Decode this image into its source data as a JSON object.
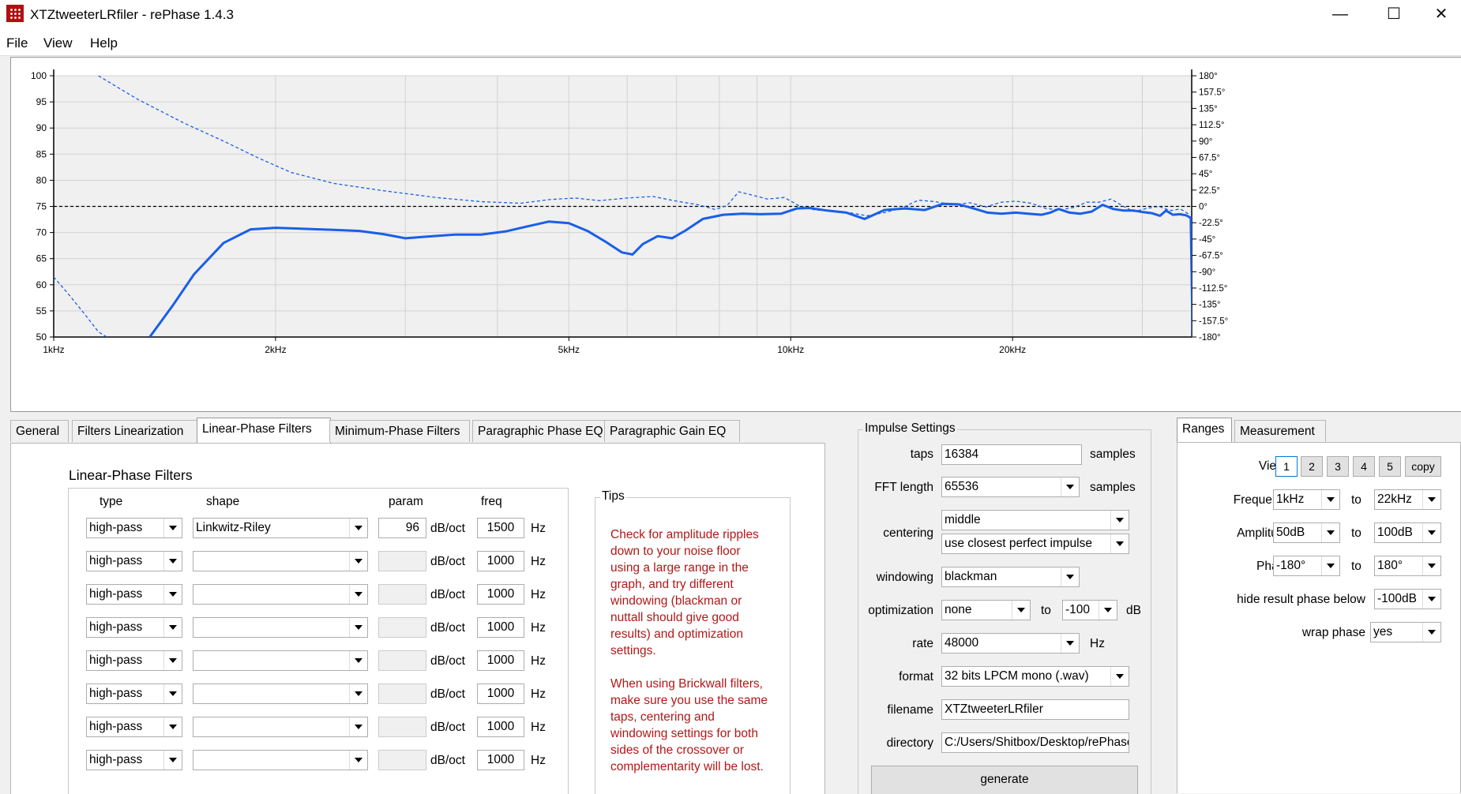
{
  "window": {
    "title": "XTZtweeterLRfiler  -  rePhase 1.4.3",
    "controls": {
      "minimize": "—",
      "maximize": "☐",
      "close": "✕"
    }
  },
  "menu": [
    "File",
    "View",
    "Help"
  ],
  "chart_data": {
    "type": "line",
    "x_scale": "log",
    "x_range_hz": [
      1000,
      22000
    ],
    "x_ticks": [
      {
        "hz": 1000,
        "label": "1kHz"
      },
      {
        "hz": 2000,
        "label": "2kHz"
      },
      {
        "hz": 5000,
        "label": "5kHz"
      },
      {
        "hz": 10000,
        "label": "10kHz"
      },
      {
        "hz": 20000,
        "label": "20kHz"
      }
    ],
    "y_left_range_db": [
      50,
      100
    ],
    "y_left_ticks": [
      "100",
      "95",
      "90",
      "85",
      "80",
      "75",
      "70",
      "65",
      "60",
      "55",
      "50"
    ],
    "y_right_ticks": [
      "180°",
      "157.5°",
      "135°",
      "112.5°",
      "90°",
      "67.5°",
      "45°",
      "22.5°",
      "0°",
      "-22.5°",
      "-45°",
      "-67.5°",
      "-90°",
      "-112.5°",
      "-135°",
      "-157.5°",
      "-180°"
    ],
    "reference_db": 75,
    "grid": true,
    "series": [
      {
        "style": "solid",
        "color": "#1a5fe6",
        "points": [
          [
            1350,
            50
          ],
          [
            1450,
            56
          ],
          [
            1550,
            62
          ],
          [
            1700,
            68
          ],
          [
            1850,
            70.6
          ],
          [
            2000,
            70.9
          ],
          [
            2200,
            70.7
          ],
          [
            2400,
            70.5
          ],
          [
            2600,
            70.3
          ],
          [
            2800,
            69.7
          ],
          [
            3000,
            68.9
          ],
          [
            3200,
            69.2
          ],
          [
            3500,
            69.6
          ],
          [
            3800,
            69.6
          ],
          [
            4100,
            70.2
          ],
          [
            4400,
            71.2
          ],
          [
            4700,
            72.1
          ],
          [
            5000,
            71.8
          ],
          [
            5300,
            70.3
          ],
          [
            5600,
            68.3
          ],
          [
            5900,
            66.2
          ],
          [
            6100,
            65.8
          ],
          [
            6300,
            67.8
          ],
          [
            6600,
            69.3
          ],
          [
            6900,
            68.9
          ],
          [
            7200,
            70.4
          ],
          [
            7600,
            72.6
          ],
          [
            8100,
            73.4
          ],
          [
            8600,
            73.6
          ],
          [
            9100,
            73.5
          ],
          [
            9700,
            73.6
          ],
          [
            10200,
            74.6
          ],
          [
            10600,
            74.7
          ],
          [
            11200,
            74.2
          ],
          [
            11900,
            73.8
          ],
          [
            12600,
            72.6
          ],
          [
            13400,
            74.3
          ],
          [
            14300,
            74.6
          ],
          [
            15200,
            74.3
          ],
          [
            16100,
            75.5
          ],
          [
            16900,
            75.4
          ],
          [
            17700,
            74.6
          ],
          [
            18500,
            73.8
          ],
          [
            19300,
            73.6
          ],
          [
            20200,
            73.8
          ],
          [
            21000,
            73.6
          ],
          [
            21900,
            73.4
          ],
          [
            22500,
            73.8
          ],
          [
            23100,
            74.5
          ],
          [
            23900,
            73.8
          ],
          [
            24700,
            73.6
          ],
          [
            25600,
            74.0
          ],
          [
            26500,
            75.3
          ],
          [
            27400,
            74.5
          ],
          [
            28300,
            74.2
          ],
          [
            29200,
            74.2
          ],
          [
            30100,
            73.9
          ],
          [
            30900,
            73.7
          ],
          [
            31700,
            73.2
          ],
          [
            32300,
            74.2
          ],
          [
            33000,
            73.4
          ],
          [
            33700,
            73.5
          ],
          [
            34400,
            73.3
          ],
          [
            34900,
            72.8
          ],
          [
            35100,
            50
          ]
        ]
      },
      {
        "style": "dashed",
        "color": "#1a5fe6",
        "points": [
          [
            1000,
            61.5
          ],
          [
            1050,
            58
          ],
          [
            1100,
            54.5
          ],
          [
            1150,
            51
          ],
          [
            1180,
            50
          ]
        ]
      },
      {
        "style": "dashed",
        "color": "#1a5fe6",
        "points": [
          [
            1150,
            100
          ],
          [
            1300,
            95.5
          ],
          [
            1500,
            91
          ],
          [
            1700,
            87.5
          ],
          [
            1900,
            84.2
          ],
          [
            2100,
            81.5
          ],
          [
            2400,
            79.4
          ],
          [
            2800,
            78.0
          ],
          [
            3300,
            76.7
          ],
          [
            3800,
            75.9
          ],
          [
            4300,
            75.6
          ],
          [
            4700,
            76.3
          ],
          [
            5100,
            76.6
          ],
          [
            5500,
            76.1
          ],
          [
            6000,
            76.6
          ],
          [
            6500,
            76.9
          ],
          [
            7000,
            76.0
          ],
          [
            7500,
            75.3
          ],
          [
            7900,
            74.4
          ],
          [
            8200,
            75.2
          ],
          [
            8500,
            77.8
          ],
          [
            8900,
            77.1
          ],
          [
            9300,
            76.4
          ],
          [
            9800,
            76.7
          ],
          [
            10300,
            75.0
          ],
          [
            10800,
            74.3
          ],
          [
            11400,
            74.2
          ],
          [
            12000,
            73.8
          ],
          [
            12700,
            73.2
          ],
          [
            13400,
            73.8
          ],
          [
            14100,
            74.6
          ],
          [
            14900,
            76.2
          ],
          [
            15700,
            75.9
          ],
          [
            16600,
            75.3
          ],
          [
            17500,
            75.7
          ],
          [
            18400,
            74.9
          ],
          [
            19300,
            75.8
          ],
          [
            20200,
            76.0
          ],
          [
            21200,
            75.6
          ],
          [
            22200,
            74.6
          ],
          [
            23200,
            74.3
          ],
          [
            24200,
            74.8
          ],
          [
            25200,
            75.8
          ],
          [
            26200,
            75.8
          ],
          [
            27200,
            76.4
          ],
          [
            28200,
            75.1
          ],
          [
            29200,
            74.0
          ],
          [
            30400,
            74.6
          ],
          [
            31600,
            75.0
          ],
          [
            32700,
            74.2
          ],
          [
            33800,
            74.5
          ],
          [
            34700,
            73.5
          ]
        ]
      }
    ]
  },
  "tabs": [
    "General",
    "Filters Linearization",
    "Linear-Phase Filters",
    "Minimum-Phase Filters",
    "Paragraphic Phase EQ",
    "Paragraphic Gain EQ"
  ],
  "active_tab": "Linear-Phase Filters",
  "linear_phase": {
    "heading": "Linear-Phase Filters",
    "col_type": "type",
    "col_shape": "shape",
    "col_param": "param",
    "col_freq": "freq",
    "param_unit": "dB/oct",
    "freq_unit": "Hz",
    "rows": [
      {
        "type": "high-pass",
        "shape": "Linkwitz-Riley",
        "param": "96",
        "freq": "1500"
      },
      {
        "type": "high-pass",
        "shape": "",
        "param": "",
        "freq": "1000"
      },
      {
        "type": "high-pass",
        "shape": "",
        "param": "",
        "freq": "1000"
      },
      {
        "type": "high-pass",
        "shape": "",
        "param": "",
        "freq": "1000"
      },
      {
        "type": "high-pass",
        "shape": "",
        "param": "",
        "freq": "1000"
      },
      {
        "type": "high-pass",
        "shape": "",
        "param": "",
        "freq": "1000"
      },
      {
        "type": "high-pass",
        "shape": "",
        "param": "",
        "freq": "1000"
      },
      {
        "type": "high-pass",
        "shape": "",
        "param": "",
        "freq": "1000"
      }
    ]
  },
  "tips": {
    "title": "Tips",
    "p1": "Check for amplitude ripples down to your noise floor using a large range in the graph, and try different windowing (blackman or nuttall should give good results) and optimization settings.",
    "p2": "When using Brickwall filters, make sure you use the same taps, centering and windowing settings for both sides of the crossover or complementarity will be lost."
  },
  "impulse": {
    "title": "Impulse Settings",
    "taps_label": "taps",
    "taps": "16384",
    "taps_unit": "samples",
    "fft_label": "FFT length",
    "fft": "65536",
    "fft_unit": "samples",
    "centering_label": "centering",
    "centering": "middle",
    "centering2": "use closest perfect impulse",
    "windowing_label": "windowing",
    "windowing": "blackman",
    "optimization_label": "optimization",
    "optimization": "none",
    "to": "to",
    "opt_db": "-100",
    "db": "dB",
    "rate_label": "rate",
    "rate": "48000",
    "rate_unit": "Hz",
    "format_label": "format",
    "format": "32 bits LPCM mono (.wav)",
    "filename_label": "filename",
    "filename": "XTZtweeterLRfiler",
    "directory_label": "directory",
    "directory": "C:/Users/Shitbox/Desktop/rePhase",
    "generate": "generate"
  },
  "ranges": {
    "tabs": [
      "Ranges",
      "Measurement"
    ],
    "views_label": "Views",
    "views": [
      "1",
      "2",
      "3",
      "4",
      "5",
      "copy"
    ],
    "to": "to",
    "frequency_label": "Frequency",
    "freq_from": "1kHz",
    "freq_to": "22kHz",
    "amplitude_label": "Amplitude",
    "amp_from": "50dB",
    "amp_to": "100dB",
    "phase_label": "Phase",
    "phase_from": "-180°",
    "phase_to": "180°",
    "hide_label": "hide result phase below",
    "hide": "-100dB",
    "wrap_label": "wrap phase",
    "wrap": "yes"
  }
}
